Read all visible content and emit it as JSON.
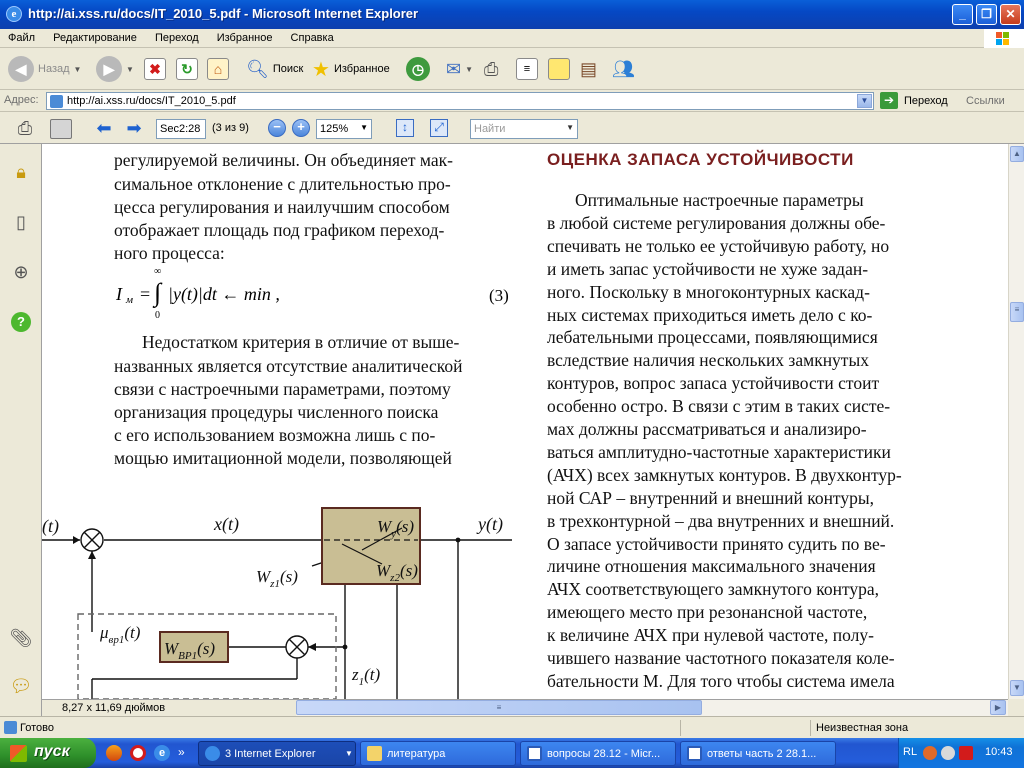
{
  "window": {
    "title": "http://ai.xss.ru/docs/IT_2010_5.pdf - Microsoft Internet Explorer",
    "ie_logo_letter": "e"
  },
  "menu": [
    "Файл",
    "Редактирование",
    "Переход",
    "Избранное",
    "Справка"
  ],
  "toolbar": {
    "back_label": "Назад",
    "search_label": "Поиск",
    "favorites_label": "Избранное"
  },
  "address": {
    "label": "Адрес:",
    "url": "http://ai.xss.ru/docs/IT_2010_5.pdf",
    "go_label": "Переход",
    "links_label": "Ссылки"
  },
  "pdf_toolbar": {
    "page_field": "Sec2:28",
    "page_count": "(3 из 9)",
    "zoom": "125%",
    "find_placeholder": "Найти"
  },
  "document": {
    "col1_lines": [
      "регулируемой величины. Он объединяет мак-",
      "симальное отклонение с длительностью про-",
      "цесса регулирования и наилучшим способом",
      "отображает площадь под графиком переход-",
      "ного процесса:"
    ],
    "equation": {
      "lhs": "I",
      "sub": "м",
      "eq": "=",
      "integral_top": "∞",
      "integral_bottom": "0",
      "body": "|y(t)|dt ← min ,",
      "number": "(3)"
    },
    "col1_para2": [
      "Недостатком критерия в отличие от выше-",
      "названных является отсутствие аналитической",
      "связи с настроечными параметрами, поэтому",
      "организация процедуры численного поиска",
      "с его использованием возможна лишь с по-",
      "мощью имитационной модели, позволяющей"
    ],
    "heading": "ОЦЕНКА ЗАПАСА УСТОЙЧИВОСТИ",
    "col2_lines": [
      "Оптимальные настроечные параметры",
      "в любой системе регулирования должны обе-",
      "спечивать не только ее устойчивую работу, но",
      "и иметь запас устойчивости не хуже задан-",
      "ного. Поскольку в многоконтурных каскад-",
      "ных системах приходиться иметь дело с ко-",
      "лебательными процессами, появляющимися",
      "вследствие наличия нескольких замкнутых",
      "контуров, вопрос запаса устойчивости стоит",
      "особенно остро. В связи с этим в таких систе-",
      "мах должны рассматриваться и анализиро-",
      "ваться амплитудно-частотные характеристики",
      "(АЧХ) всех замкнутых контуров. В двухконтур-",
      "ной САР – внутренний и внешний контуры,",
      "в трехконтурной – два внутренних и внешний.",
      "О запасе устойчивости принято судить по ве-",
      "личине отношения максимального значения",
      "АЧХ соответствующего замкнутого контура,",
      "имеющего место при резонансной частоте,",
      "к величине АЧХ при нулевой частоте, полу-",
      "чившего название частотного показателя коле-",
      "бательности М. Для того чтобы система имела"
    ],
    "diagram": {
      "in_label": "(t)",
      "x_label": "x(t)",
      "y_label": "y(t)",
      "wy": "W",
      "wy_sub": "y",
      "wy_arg": "(s)",
      "wz1": "W",
      "wz1_sub": "z1",
      "wz1_arg": "(s)",
      "wz2": "W",
      "wz2_sub": "z2",
      "wz2_arg": "(s)",
      "wbp": "W",
      "wbp_sub": "ВР1",
      "wbp_arg": "(s)",
      "mu": "μ",
      "mu_sub": "вр1",
      "mu_arg": "(t)",
      "z1": "z",
      "z1_sub": "1",
      "z1_arg": "(t)"
    }
  },
  "page_size": "8,27 x 11,69 дюймов",
  "status": {
    "left": "Готово",
    "zone": "Неизвестная зона"
  },
  "taskbar": {
    "start": "пуск",
    "tasks": [
      {
        "label": "3 Internet Explorer",
        "active": true
      },
      {
        "label": "литература",
        "active": false
      },
      {
        "label": "вопросы 28.12 - Micr...",
        "active": false
      },
      {
        "label": "ответы часть 2 28.1...",
        "active": false
      }
    ],
    "lang": "RL",
    "clock": "10:43"
  },
  "colors": {
    "heading": "#7A1F1F",
    "block_fill": "#C9BE94",
    "block_border": "#5A2A20"
  }
}
